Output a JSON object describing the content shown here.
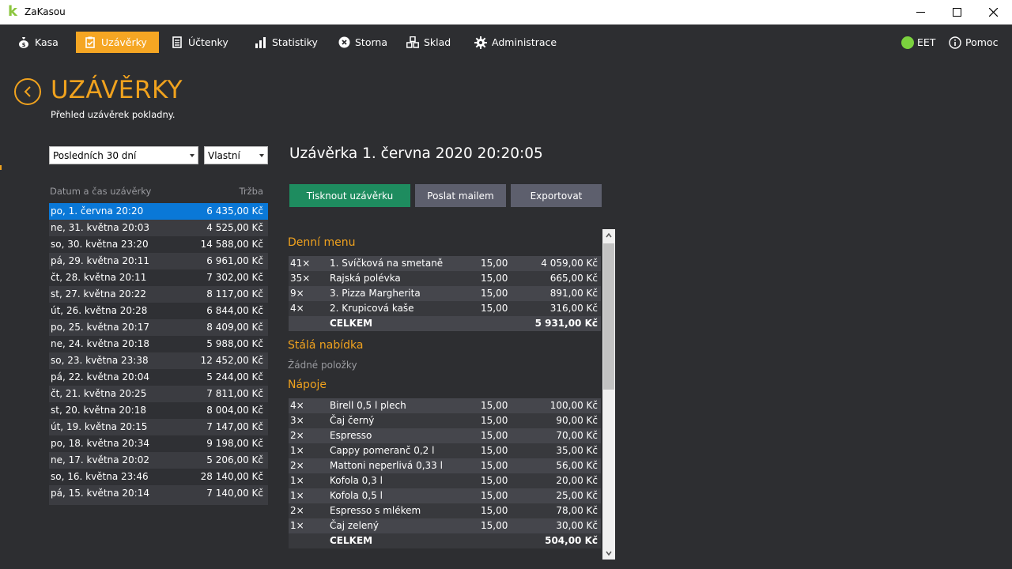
{
  "window": {
    "title": "ZaKasou",
    "logo_letter": "k"
  },
  "nav": {
    "items": [
      {
        "label": "Kasa",
        "icon": "money-bag-icon"
      },
      {
        "label": "Uzávěrky",
        "icon": "clipboard-check-icon",
        "active": true
      },
      {
        "label": "Účtenky",
        "icon": "receipt-icon"
      },
      {
        "label": "Statistiky",
        "icon": "bar-chart-icon"
      },
      {
        "label": "Storna",
        "icon": "cancel-circle-icon"
      },
      {
        "label": "Sklad",
        "icon": "boxes-icon"
      },
      {
        "label": "Administrace",
        "icon": "gear-icon"
      }
    ],
    "eet_label": "EET",
    "eet_status_color": "#7bd13e",
    "help_label": "Pomoc"
  },
  "header": {
    "title": "UZÁVĚRKY",
    "subtitle": "Přehled uzávěrek pokladny."
  },
  "filters": {
    "period_value": "Posledních 30 dní",
    "custom_value": "Vlastní"
  },
  "list": {
    "col_date": "Datum a čas uzávěrky",
    "col_amount": "Tržba",
    "rows": [
      {
        "date": "po, 1. června 20:20",
        "amount": "6 435,00 Kč",
        "selected": true
      },
      {
        "date": "ne, 31. května 20:03",
        "amount": "4 525,00 Kč"
      },
      {
        "date": "so, 30. května 23:20",
        "amount": "14 588,00 Kč"
      },
      {
        "date": "pá, 29. května 20:11",
        "amount": "6 961,00 Kč"
      },
      {
        "date": "čt, 28. května 20:11",
        "amount": "7 302,00 Kč"
      },
      {
        "date": "st, 27. května 20:22",
        "amount": "8 117,00 Kč"
      },
      {
        "date": "út, 26. května 20:28",
        "amount": "6 844,00 Kč"
      },
      {
        "date": "po, 25. května 20:17",
        "amount": "8 409,00 Kč"
      },
      {
        "date": "ne, 24. května 20:18",
        "amount": "5 988,00 Kč"
      },
      {
        "date": "so, 23. května 23:38",
        "amount": "12 452,00 Kč"
      },
      {
        "date": "pá, 22. května 20:04",
        "amount": "5 244,00 Kč"
      },
      {
        "date": "čt, 21. května 20:25",
        "amount": "7 811,00 Kč"
      },
      {
        "date": "st, 20. května 20:18",
        "amount": "8 004,00 Kč"
      },
      {
        "date": "út, 19. května 20:15",
        "amount": "7 147,00 Kč"
      },
      {
        "date": "po, 18. května 20:34",
        "amount": "9 198,00 Kč"
      },
      {
        "date": "ne, 17. května 20:02",
        "amount": "5 206,00 Kč"
      },
      {
        "date": "so, 16. května 23:46",
        "amount": "28 140,00 Kč"
      },
      {
        "date": "pá, 15. května 20:14",
        "amount": "7 140,00 Kč"
      }
    ]
  },
  "detail": {
    "title": "Uzávěrka 1. června 2020 20:20:05",
    "buttons": {
      "print": "Tisknout uzávěrku",
      "email": "Poslat mailem",
      "export": "Exportovat"
    },
    "sections": {
      "denni": {
        "title": "Denní menu",
        "rows": [
          {
            "qty": "41×",
            "name": "1. Svíčková na smetaně",
            "price": "15,00",
            "total": "4 059,00 Kč"
          },
          {
            "qty": "35×",
            "name": "Rajská polévka",
            "price": "15,00",
            "total": "665,00 Kč"
          },
          {
            "qty": "9×",
            "name": "3. Pizza Margherita",
            "price": "15,00",
            "total": "891,00 Kč"
          },
          {
            "qty": "4×",
            "name": "2. Krupicová kaše",
            "price": "15,00",
            "total": "316,00 Kč"
          }
        ],
        "sum_label": "CELKEM",
        "sum_total": "5 931,00 Kč"
      },
      "stala": {
        "title": "Stálá nabídka",
        "empty": "Žádné položky"
      },
      "napoje": {
        "title": "Nápoje",
        "rows": [
          {
            "qty": "4×",
            "name": "Birell 0,5 l plech",
            "price": "15,00",
            "total": "100,00 Kč"
          },
          {
            "qty": "3×",
            "name": "Čaj černý",
            "price": "15,00",
            "total": "90,00 Kč"
          },
          {
            "qty": "2×",
            "name": "Espresso",
            "price": "15,00",
            "total": "70,00 Kč"
          },
          {
            "qty": "1×",
            "name": "Cappy pomeranč 0,2 l",
            "price": "15,00",
            "total": "35,00 Kč"
          },
          {
            "qty": "2×",
            "name": "Mattoni neperlivá 0,33 l",
            "price": "15,00",
            "total": "56,00 Kč"
          },
          {
            "qty": "1×",
            "name": "Kofola 0,3 l",
            "price": "15,00",
            "total": "20,00 Kč"
          },
          {
            "qty": "1×",
            "name": "Kofola 0,5 l",
            "price": "15,00",
            "total": "25,00 Kč"
          },
          {
            "qty": "2×",
            "name": "Espresso s mlékem",
            "price": "15,00",
            "total": "78,00 Kč"
          },
          {
            "qty": "1×",
            "name": "Čaj zelený",
            "price": "15,00",
            "total": "30,00 Kč"
          }
        ],
        "sum_label": "CELKEM",
        "sum_total": "504,00 Kč"
      }
    }
  },
  "colors": {
    "accent": "#f0a21e",
    "selected_row": "#0a78d7",
    "print_button": "#1e8c5f",
    "secondary_button": "#5d5f6d",
    "background": "#2d2e31"
  }
}
